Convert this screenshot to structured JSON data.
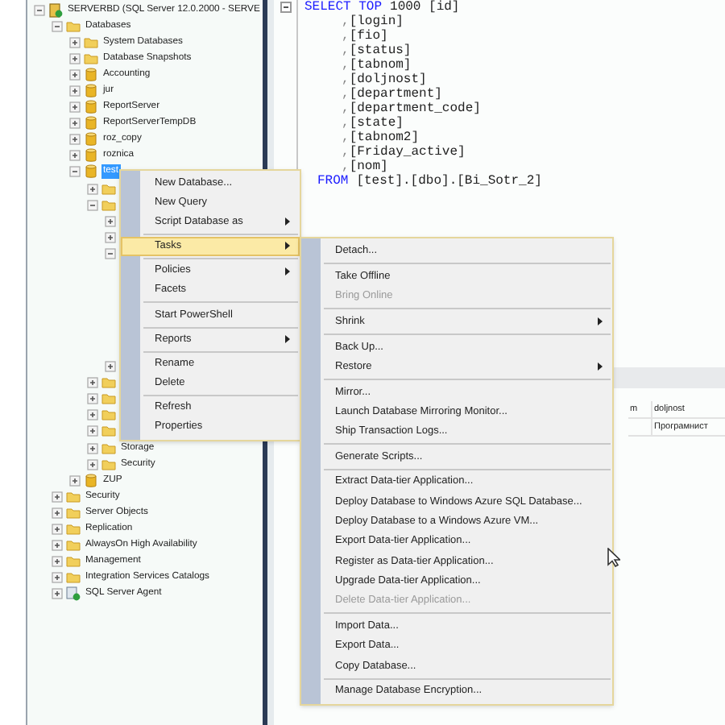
{
  "object_explorer": {
    "tree": [
      {
        "label": "SERVERBD (SQL Server 12.0.2000 - SERVE",
        "kind": "server",
        "expanded": true,
        "selected": false,
        "children": [
          {
            "label": "Databases",
            "kind": "folder",
            "expanded": true,
            "selected": false,
            "children": [
              {
                "label": "System Databases",
                "kind": "folder",
                "expanded": false,
                "selected": false
              },
              {
                "label": "Database Snapshots",
                "kind": "folder",
                "expanded": false,
                "selected": false
              },
              {
                "label": "Accounting",
                "kind": "database",
                "expanded": false,
                "selected": false
              },
              {
                "label": "jur",
                "kind": "database",
                "expanded": false,
                "selected": false
              },
              {
                "label": "ReportServer",
                "kind": "database",
                "expanded": false,
                "selected": false
              },
              {
                "label": "ReportServerTempDB",
                "kind": "database",
                "expanded": false,
                "selected": false
              },
              {
                "label": "roz_copy",
                "kind": "database",
                "expanded": false,
                "selected": false
              },
              {
                "label": "roznica",
                "kind": "database",
                "expanded": false,
                "selected": false
              },
              {
                "label": "test",
                "kind": "database",
                "expanded": true,
                "selected": true,
                "children": [
                  {
                    "kind": "folder",
                    "expanded": false
                  },
                  {
                    "kind": "folder",
                    "expanded": true,
                    "children": [
                      {
                        "expanded": false
                      },
                      {
                        "expanded": false
                      },
                      {
                        "expanded": true
                      },
                      {
                        "expanded": false
                      }
                    ]
                  },
                  {
                    "kind": "folder",
                    "expanded": false
                  },
                  {
                    "kind": "folder",
                    "expanded": false
                  },
                  {
                    "kind": "folder",
                    "expanded": false
                  },
                  {
                    "kind": "folder",
                    "expanded": false
                  },
                  {
                    "label": "Storage",
                    "kind": "folder",
                    "expanded": false,
                    "selected": false
                  },
                  {
                    "label": "Security",
                    "kind": "folder",
                    "expanded": false,
                    "selected": false
                  }
                ]
              },
              {
                "label": "ZUP",
                "kind": "database",
                "expanded": false,
                "selected": false
              }
            ]
          },
          {
            "label": "Security",
            "kind": "folder",
            "expanded": false,
            "selected": false
          },
          {
            "label": "Server Objects",
            "kind": "folder",
            "expanded": false,
            "selected": false
          },
          {
            "label": "Replication",
            "kind": "folder",
            "expanded": false,
            "selected": false
          },
          {
            "label": "AlwaysOn High Availability",
            "kind": "folder",
            "expanded": false,
            "selected": false
          },
          {
            "label": "Management",
            "kind": "folder",
            "expanded": false,
            "selected": false
          },
          {
            "label": "Integration Services Catalogs",
            "kind": "folder",
            "expanded": false,
            "selected": false
          },
          {
            "label": "SQL Server Agent",
            "kind": "agent",
            "expanded": false,
            "selected": false
          }
        ]
      }
    ]
  },
  "editor": {
    "lines": [
      {
        "kind": "select",
        "keyword": "SELECT TOP",
        "text": "1000 [id]"
      },
      {
        "kind": "column",
        "comma": ",",
        "text": "[login]"
      },
      {
        "kind": "column",
        "comma": ",",
        "text": "[fio]"
      },
      {
        "kind": "column",
        "comma": ",",
        "text": "[status]"
      },
      {
        "kind": "column",
        "comma": ",",
        "text": "[tabnom]"
      },
      {
        "kind": "column",
        "comma": ",",
        "text": "[doljnost]"
      },
      {
        "kind": "column",
        "comma": ",",
        "text": "[department]"
      },
      {
        "kind": "column",
        "comma": ",",
        "text": "[department_code]"
      },
      {
        "kind": "column",
        "comma": ",",
        "text": "[state]"
      },
      {
        "kind": "column",
        "comma": ",",
        "text": "[tabnom2]"
      },
      {
        "kind": "column",
        "comma": ",",
        "text": "[Friday_active]"
      },
      {
        "kind": "column",
        "comma": ",",
        "text": "[nom]"
      },
      {
        "kind": "from",
        "keyword": "FROM",
        "text": "[test].[dbo].[Bi_Sotr_2]"
      }
    ]
  },
  "results": {
    "columns": [
      "m",
      "doljnost"
    ],
    "rows": [
      [
        "",
        "Програмнист"
      ]
    ]
  },
  "context_menu": {
    "items": [
      {
        "kind": "item",
        "label": "New Database...",
        "submenu": false,
        "selected": false
      },
      {
        "kind": "item",
        "label": "New Query",
        "submenu": false,
        "selected": false
      },
      {
        "kind": "item",
        "label": "Script Database as",
        "submenu": true,
        "selected": false
      },
      {
        "kind": "separator"
      },
      {
        "kind": "item",
        "label": "Tasks",
        "submenu": true,
        "selected": true
      },
      {
        "kind": "separator"
      },
      {
        "kind": "item",
        "label": "Policies",
        "submenu": true,
        "selected": false
      },
      {
        "kind": "item",
        "label": "Facets",
        "submenu": false,
        "selected": false
      },
      {
        "kind": "separator"
      },
      {
        "kind": "item",
        "label": "Start PowerShell",
        "submenu": false,
        "selected": false
      },
      {
        "kind": "separator"
      },
      {
        "kind": "item",
        "label": "Reports",
        "submenu": true,
        "selected": false
      },
      {
        "kind": "separator"
      },
      {
        "kind": "item",
        "label": "Rename",
        "submenu": false,
        "selected": false
      },
      {
        "kind": "item",
        "label": "Delete",
        "submenu": false,
        "selected": false
      },
      {
        "kind": "separator"
      },
      {
        "kind": "item",
        "label": "Refresh",
        "submenu": false,
        "selected": false
      },
      {
        "kind": "item",
        "label": "Properties",
        "submenu": false,
        "selected": false
      }
    ]
  },
  "tasks_submenu": {
    "items": [
      {
        "kind": "item",
        "label": "Detach...",
        "submenu": false,
        "disabled": false
      },
      {
        "kind": "separator"
      },
      {
        "kind": "item",
        "label": "Take Offline",
        "submenu": false,
        "disabled": false
      },
      {
        "kind": "item",
        "label": "Bring Online",
        "submenu": false,
        "disabled": true
      },
      {
        "kind": "separator"
      },
      {
        "kind": "item",
        "label": "Shrink",
        "submenu": true,
        "disabled": false
      },
      {
        "kind": "separator"
      },
      {
        "kind": "item",
        "label": "Back Up...",
        "submenu": false,
        "disabled": false
      },
      {
        "kind": "item",
        "label": "Restore",
        "submenu": true,
        "disabled": false
      },
      {
        "kind": "separator"
      },
      {
        "kind": "item",
        "label": "Mirror...",
        "submenu": false,
        "disabled": false
      },
      {
        "kind": "item",
        "label": "Launch Database Mirroring Monitor...",
        "submenu": false,
        "disabled": false
      },
      {
        "kind": "item",
        "label": "Ship Transaction Logs...",
        "submenu": false,
        "disabled": false
      },
      {
        "kind": "separator"
      },
      {
        "kind": "item",
        "label": "Generate Scripts...",
        "submenu": false,
        "disabled": false
      },
      {
        "kind": "separator"
      },
      {
        "kind": "item",
        "label": "Extract Data-tier Application...",
        "submenu": false,
        "disabled": false
      },
      {
        "kind": "item",
        "label": "Deploy Database to Windows Azure SQL Database...",
        "submenu": false,
        "disabled": false
      },
      {
        "kind": "item",
        "label": "Deploy Database to a Windows Azure VM...",
        "submenu": false,
        "disabled": false
      },
      {
        "kind": "item",
        "label": "Export Data-tier Application...",
        "submenu": false,
        "disabled": false
      },
      {
        "kind": "item",
        "label": "Register as Data-tier Application...",
        "submenu": false,
        "disabled": false
      },
      {
        "kind": "item",
        "label": "Upgrade Data-tier Application...",
        "submenu": false,
        "disabled": false
      },
      {
        "kind": "item",
        "label": "Delete Data-tier Application...",
        "submenu": false,
        "disabled": true
      },
      {
        "kind": "separator"
      },
      {
        "kind": "item",
        "label": "Import Data...",
        "submenu": false,
        "disabled": false
      },
      {
        "kind": "item",
        "label": "Export Data...",
        "submenu": false,
        "disabled": false
      },
      {
        "kind": "item",
        "label": "Copy Database...",
        "submenu": false,
        "disabled": false
      },
      {
        "kind": "separator"
      },
      {
        "kind": "item",
        "label": "Manage Database Encryption...",
        "submenu": false,
        "disabled": false
      }
    ]
  }
}
